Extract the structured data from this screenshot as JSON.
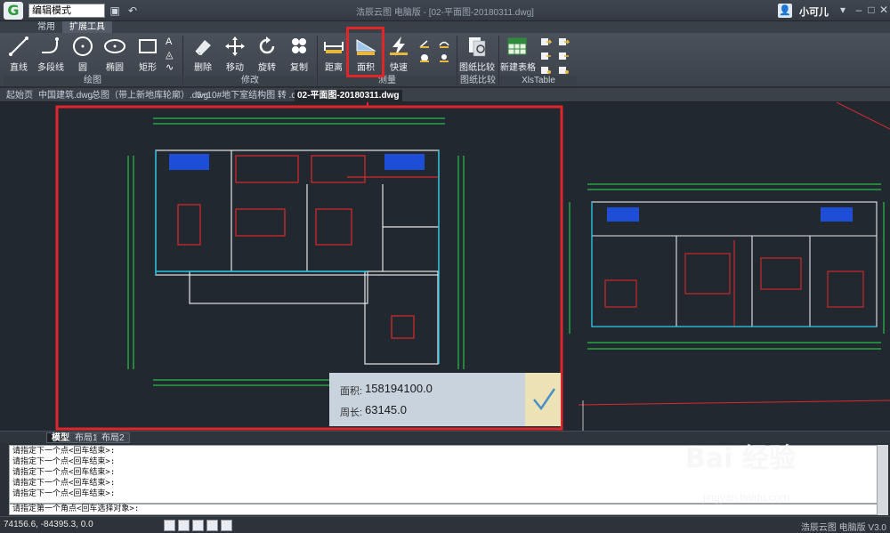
{
  "app": {
    "mode": "编辑模式",
    "window_title": "浩辰云图 电脑版 - [02-平面图-20180311.dwg]",
    "user": "小可儿"
  },
  "ribbon_tabs": [
    {
      "label": "常用",
      "active": false
    },
    {
      "label": "扩展工具",
      "active": true
    }
  ],
  "ribbon": {
    "buttons": {
      "line": "直线",
      "polyline": "多段线",
      "circle": "圆",
      "ellipse": "椭圆",
      "rect": "矩形",
      "erase": "删除",
      "move": "移动",
      "rotate": "旋转",
      "copy": "复制",
      "distance": "距离",
      "area": "面积",
      "quick": "快速",
      "compare": "图纸比较",
      "new_table": "新建表格"
    },
    "groups": {
      "draw": "绘图",
      "modify": "修改",
      "measure": "测量",
      "compare": "图纸比较",
      "xls": "XlsTable"
    }
  },
  "doc_tabs": [
    {
      "label": "起始页",
      "active": false
    },
    {
      "label": "中国建筑.dwg",
      "active": false
    },
    {
      "label": "总图（带上新地库轮廓）.dwg",
      "active": false
    },
    {
      "label": "5~10#地下室结构图 转 .dwg",
      "active": false
    },
    {
      "label": "02-平面图-20180311.dwg",
      "active": true
    }
  ],
  "layout_tabs": [
    {
      "label": "模型",
      "active": true
    },
    {
      "label": "布局1",
      "active": false
    },
    {
      "label": "布局2",
      "active": false
    }
  ],
  "measure_result": {
    "area_label": "面积:",
    "area_value": "158194100.0",
    "perimeter_label": "周长:",
    "perimeter_value": "63145.0"
  },
  "command": {
    "history": [
      "请指定下一个点<回车结束>:",
      "请指定下一个点<回车结束>:",
      "请指定下一个点<回车结束>:",
      "请指定下一个点<回车结束>:",
      "请指定下一个点<回车结束>:"
    ],
    "prompt": "请指定第一个角点<回车选择对象>:"
  },
  "status": {
    "coords": "74156.6, -84395.3, 0.0",
    "brand": "浩辰云图 电脑版 V3.0"
  },
  "watermark": {
    "main": "Bai 经验",
    "sub": "jingyan.baidu.com"
  }
}
